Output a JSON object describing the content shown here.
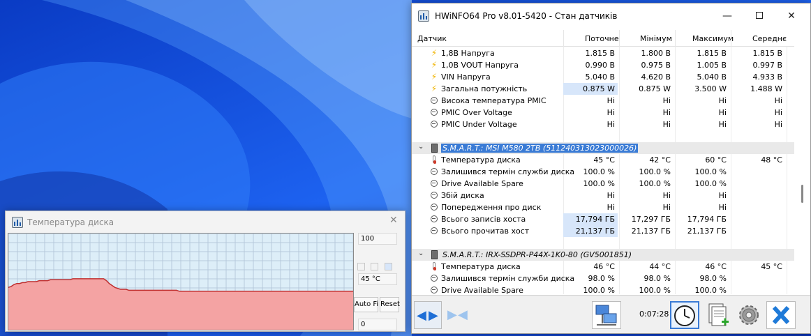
{
  "main_window": {
    "title": "HWiNFO64 Pro v8.01-5420 - Стан датчиків",
    "columns": [
      "Датчик",
      "Поточне",
      "Мінімум",
      "Максимум",
      "Середнє"
    ],
    "rows": [
      {
        "icon": "bolt-icon",
        "label": "1,8В Напруга",
        "cur": "1.815 В",
        "min": "1.800 В",
        "max": "1.815 В",
        "avg": "1.815 В"
      },
      {
        "icon": "bolt-icon",
        "label": "1,0В VOUT Напруга",
        "cur": "0.990 В",
        "min": "0.975 В",
        "max": "1.005 В",
        "avg": "0.997 В"
      },
      {
        "icon": "bolt-icon",
        "label": "VIN Напруга",
        "cur": "5.040 В",
        "min": "4.620 В",
        "max": "5.040 В",
        "avg": "4.933 В"
      },
      {
        "icon": "bolt-icon",
        "label": "Загальна потужність",
        "cur": "0.875 W",
        "min": "0.875 W",
        "max": "3.500 W",
        "avg": "1.488 W",
        "highlight": true
      },
      {
        "icon": "status-icon",
        "label": "Висока температура PMIC",
        "cur": "Ні",
        "min": "Ні",
        "max": "Ні",
        "avg": "Ні"
      },
      {
        "icon": "status-icon",
        "label": "PMIC Over Voltage",
        "cur": "Ні",
        "min": "Ні",
        "max": "Ні",
        "avg": "Ні"
      },
      {
        "icon": "status-icon",
        "label": "PMIC Under Voltage",
        "cur": "Ні",
        "min": "Ні",
        "max": "Ні",
        "avg": "Ні"
      }
    ],
    "group1": {
      "name": "S.M.A.R.T.: MSI M580 2TB (511240313023000026)",
      "rows": [
        {
          "icon": "thermometer-icon",
          "label": "Температура диска",
          "cur": "45 °C",
          "min": "42 °C",
          "max": "60 °C",
          "avg": "48 °C"
        },
        {
          "icon": "status-icon",
          "label": "Залишився термін служби диска",
          "cur": "100.0 %",
          "min": "100.0 %",
          "max": "100.0 %",
          "avg": ""
        },
        {
          "icon": "status-icon",
          "label": "Drive Available Spare",
          "cur": "100.0 %",
          "min": "100.0 %",
          "max": "100.0 %",
          "avg": ""
        },
        {
          "icon": "status-icon",
          "label": "Збій диска",
          "cur": "Ні",
          "min": "Ні",
          "max": "Ні",
          "avg": ""
        },
        {
          "icon": "status-icon",
          "label": "Попередження про диск",
          "cur": "Ні",
          "min": "Ні",
          "max": "Ні",
          "avg": ""
        },
        {
          "icon": "status-icon",
          "label": "Всього записів хоста",
          "cur": "17,794 ГБ",
          "min": "17,297 ГБ",
          "max": "17,794 ГБ",
          "avg": "",
          "highlight": true
        },
        {
          "icon": "status-icon",
          "label": "Всього прочитав хост",
          "cur": "21,137 ГБ",
          "min": "21,137 ГБ",
          "max": "21,137 ГБ",
          "avg": "",
          "highlight": true
        }
      ]
    },
    "group2": {
      "name": "S.M.A.R.T.: IRX-SSDPR-P44X-1K0-80 (GV5001851)",
      "rows": [
        {
          "icon": "thermometer-icon",
          "label": "Температура диска",
          "cur": "46 °C",
          "min": "44 °C",
          "max": "46 °C",
          "avg": "45 °C"
        },
        {
          "icon": "status-icon",
          "label": "Залишився термін служби диска",
          "cur": "98.0 %",
          "min": "98.0 %",
          "max": "98.0 %",
          "avg": ""
        },
        {
          "icon": "status-icon",
          "label": "Drive Available Spare",
          "cur": "100.0 %",
          "min": "100.0 %",
          "max": "100.0 %",
          "avg": ""
        }
      ]
    },
    "elapsed_time": "0:07:28"
  },
  "graph_window": {
    "title": "Температура диска",
    "max_value": "100",
    "current_value": "45 °C",
    "min_value": "0",
    "auto_fit_label": "Auto Fi",
    "reset_label": "Reset"
  },
  "chart_data": {
    "type": "area",
    "ylim": [
      0,
      100
    ],
    "color": "#f4a3a3",
    "grid": true,
    "values": [
      44,
      45,
      47,
      48,
      48,
      49,
      49,
      50,
      50,
      50,
      50,
      51,
      51,
      51,
      51,
      52,
      52,
      52,
      52,
      52,
      52,
      52,
      52,
      53,
      53,
      53,
      53,
      53,
      53,
      53,
      53,
      53,
      53,
      53,
      53,
      51,
      48,
      46,
      44,
      43,
      42,
      42,
      42,
      41,
      41,
      41,
      41,
      41,
      41,
      41,
      41,
      41,
      41,
      41,
      41,
      41,
      41,
      41,
      41,
      41,
      41,
      40,
      40,
      40,
      40,
      40,
      40,
      40,
      40,
      40,
      40,
      40,
      40,
      40,
      40,
      40,
      40,
      40,
      40,
      40,
      40,
      40,
      40,
      40,
      40,
      40,
      40,
      40,
      40,
      40,
      40,
      40,
      40,
      40,
      40,
      40,
      40,
      40,
      40,
      40,
      40,
      40,
      40,
      40,
      40,
      40,
      40,
      40,
      40,
      40,
      40,
      40,
      40,
      40,
      40,
      40,
      40,
      40,
      40,
      40,
      40,
      40,
      40,
      40
    ]
  }
}
